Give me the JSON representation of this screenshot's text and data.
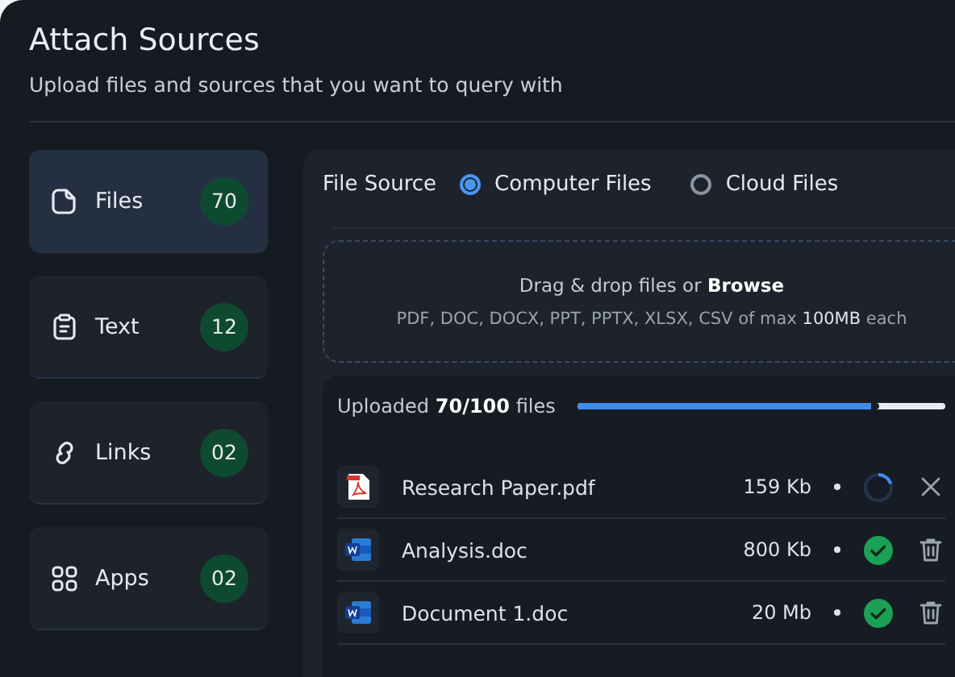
{
  "header": {
    "title": "Attach Sources",
    "subtitle": "Upload files and sources that you want to query with"
  },
  "sidebar": {
    "items": [
      {
        "kind": "files",
        "label": "Files",
        "count": "70",
        "selected": true
      },
      {
        "kind": "text",
        "label": "Text",
        "count": "12",
        "selected": false
      },
      {
        "kind": "links",
        "label": "Links",
        "count": "02",
        "selected": false
      },
      {
        "kind": "apps",
        "label": "Apps",
        "count": "02",
        "selected": false
      }
    ]
  },
  "file_source": {
    "label": "File Source",
    "options": [
      {
        "label": "Computer Files",
        "selected": true
      },
      {
        "label": "Cloud Files",
        "selected": false
      }
    ]
  },
  "dropzone": {
    "instruction": "Drag & drop files or **Browse**",
    "formats": "PDF, DOC, DOCX, PPT, PPTX, XLSX, CSV of max **100MB** each"
  },
  "upload": {
    "summary": "Uploaded **70/100** files",
    "level": 0.8,
    "files": [
      {
        "kind": "pdf",
        "name": "Research Paper.pdf",
        "size": "159 Kb",
        "uploading": true
      },
      {
        "kind": "doc",
        "name": "Analysis.doc",
        "size": "800 Kb",
        "uploading": false
      },
      {
        "kind": "doc",
        "name": "Document 1.doc",
        "size": "20 Mb",
        "uploading": false
      }
    ]
  }
}
